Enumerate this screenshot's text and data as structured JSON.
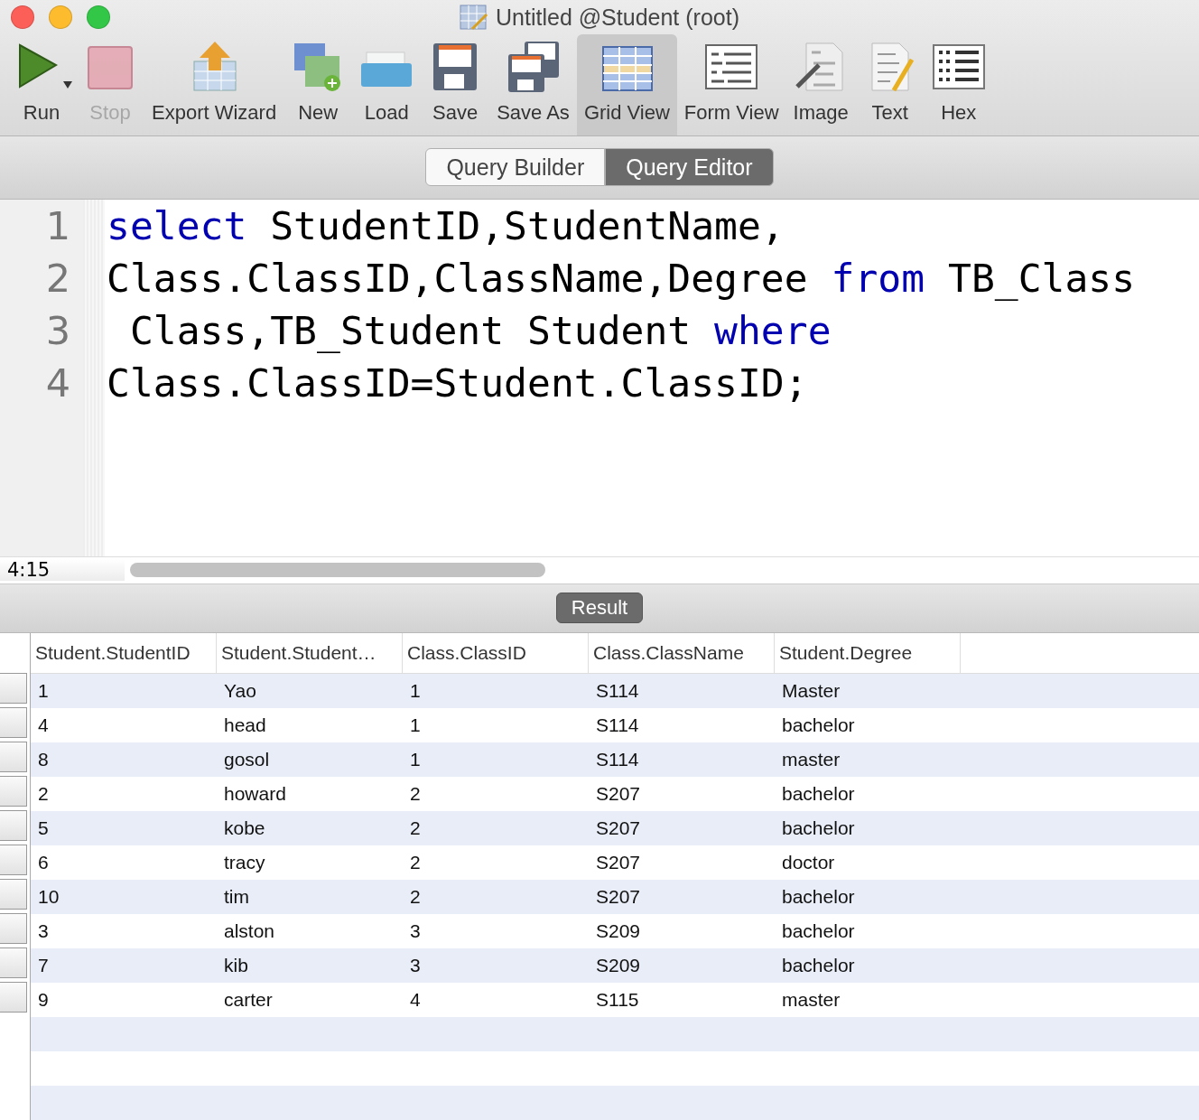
{
  "window": {
    "title": "Untitled @Student (root)"
  },
  "toolbar": [
    {
      "label": "Run",
      "selected": false,
      "disabled": false,
      "menu": true
    },
    {
      "label": "Stop",
      "selected": false,
      "disabled": true,
      "menu": false
    },
    {
      "label": "Export Wizard",
      "selected": false,
      "disabled": false,
      "menu": false
    },
    {
      "label": "New",
      "selected": false,
      "disabled": false,
      "menu": false
    },
    {
      "label": "Load",
      "selected": false,
      "disabled": false,
      "menu": false
    },
    {
      "label": "Save",
      "selected": false,
      "disabled": false,
      "menu": false
    },
    {
      "label": "Save As",
      "selected": false,
      "disabled": false,
      "menu": false
    },
    {
      "label": "Grid View",
      "selected": true,
      "disabled": false,
      "menu": false
    },
    {
      "label": "Form View",
      "selected": false,
      "disabled": false,
      "menu": false
    },
    {
      "label": "Image",
      "selected": false,
      "disabled": false,
      "menu": false
    },
    {
      "label": "Text",
      "selected": false,
      "disabled": false,
      "menu": false
    },
    {
      "label": "Hex",
      "selected": false,
      "disabled": false,
      "menu": false
    }
  ],
  "mode_tabs": [
    {
      "label": "Query Builder",
      "selected": false
    },
    {
      "label": "Query Editor",
      "selected": true
    }
  ],
  "editor": {
    "lines": [
      {
        "number": "1",
        "tokens": [
          {
            "text": "select",
            "kind": "keyword"
          },
          {
            "text": " StudentID,StudentName,",
            "kind": "plain"
          }
        ]
      },
      {
        "number": "2",
        "tokens": [
          {
            "text": "Class.ClassID,ClassName,Degree ",
            "kind": "plain"
          },
          {
            "text": "from",
            "kind": "keyword"
          },
          {
            "text": " TB_Class",
            "kind": "plain"
          }
        ]
      },
      {
        "number": "3",
        "tokens": [
          {
            "text": " Class,TB_Student Student ",
            "kind": "plain"
          },
          {
            "text": "where",
            "kind": "keyword"
          }
        ]
      },
      {
        "number": "4",
        "tokens": [
          {
            "text": "Class.ClassID=Student.ClassID;",
            "kind": "plain"
          }
        ]
      }
    ]
  },
  "status_bar": {
    "cursor": "4:15"
  },
  "result_tab": {
    "label": "Result",
    "selected": true
  },
  "table": {
    "columns": [
      "Student.StudentID",
      "Student.Student…",
      "Class.ClassID",
      "Class.ClassName",
      "Student.Degree"
    ],
    "rows": [
      [
        "1",
        "Yao",
        "1",
        "S114",
        "Master"
      ],
      [
        "4",
        "head",
        "1",
        "S114",
        "bachelor"
      ],
      [
        "8",
        "gosol",
        "1",
        "S114",
        "master"
      ],
      [
        "2",
        "howard",
        "2",
        "S207",
        "bachelor"
      ],
      [
        "5",
        "kobe",
        "2",
        "S207",
        "bachelor"
      ],
      [
        "6",
        "tracy",
        "2",
        "S207",
        "doctor"
      ],
      [
        "10",
        "tim",
        "2",
        "S207",
        "bachelor"
      ],
      [
        "3",
        "alston",
        "3",
        "S209",
        "bachelor"
      ],
      [
        "7",
        "kib",
        "3",
        "S209",
        "bachelor"
      ],
      [
        "9",
        "carter",
        "4",
        "S115",
        "master"
      ]
    ]
  }
}
